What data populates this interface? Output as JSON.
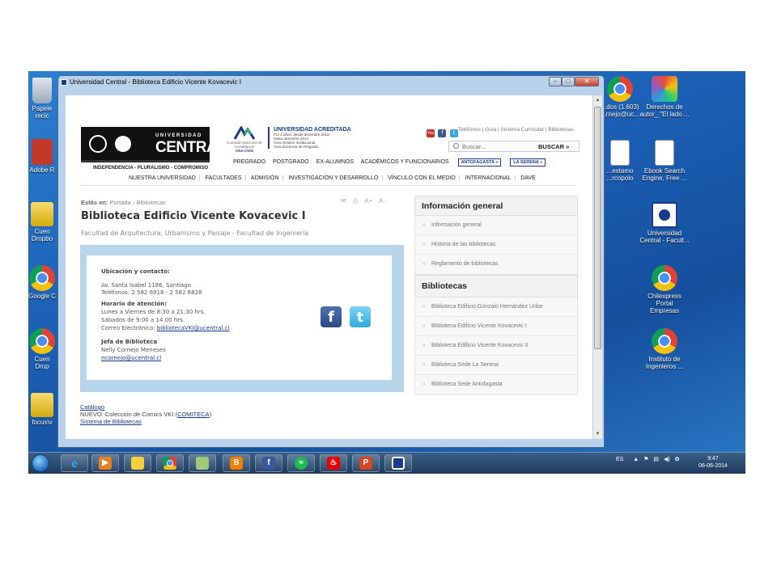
{
  "desktop": {
    "icons_left": [
      {
        "label": "Papelera de\nreciclaje",
        "visible": "Papele\nrecic",
        "icon": "recycle-bin-icon"
      },
      {
        "label": "Adobe Reader",
        "visible": "Adobe R",
        "icon": "pdf-icon"
      },
      {
        "label": "Cuenta Dropbox",
        "visible": "Cuen\nDropbo",
        "icon": "folder-icon"
      },
      {
        "label": "Google Chrome",
        "visible": "Google C",
        "icon": "chrome-icon"
      },
      {
        "label": "Cuenta Dropbox",
        "visible": "Cuen\nDrop",
        "icon": "chrome-icon"
      },
      {
        "label": "focus",
        "visible": "focus\\v",
        "icon": "folder-icon"
      }
    ],
    "icons_right": [
      {
        "label": "...dos (1.603)\n...rnejo@uc...",
        "icon": "chrome-icon"
      },
      {
        "label": "Derechos de\nautor_ \"El lado ...",
        "icon": "color-wheel-icon"
      },
      {
        "label": "...estamo\n...rcopolo",
        "icon": "document-icon"
      },
      {
        "label": "Ebook Search\nEngine, Free ...",
        "icon": "document-icon"
      },
      {
        "label": "Universidad\nCentral - Facult...",
        "icon": "uc-shortcut-icon"
      },
      {
        "label": "Chilexpress Portal\nEmpresas",
        "icon": "chrome-icon"
      },
      {
        "label": "Instituto de\nIngenieros ...",
        "icon": "chrome-icon"
      }
    ]
  },
  "window": {
    "title": "Universidad Central - Biblioteca Edificio Vicente Kovacevic I",
    "min": "–",
    "max": "□",
    "close": "✕"
  },
  "site": {
    "logo_univ": "UNIVERSIDAD",
    "logo_central": "CENTRAL",
    "motto": "INDEPENDENCIA - PLURALISMO - COMPROMISO",
    "cna_name": "Comisión Nacional de Acreditación",
    "cna_short": "CNA-Chile",
    "acred_title": "UNIVERSIDAD ACREDITADA",
    "acred_details": "Por 2 años, desde diciembre 2012,\nhasta diciembre 2014\nÁrea Gestión Institucional\nÁrea Docencia de Pregrado",
    "youtube": "You",
    "top_links": "Teléfonos  |  Guía  |  Sistema Curricular  |  Bibliotecas",
    "search_placeholder": "Buscar...",
    "search_button": "BUSCAR »",
    "main_nav": [
      "PREGRADO",
      "POSTGRADO",
      "EX-ALUMNOS",
      "ACADÉMICOS Y FUNCIONARIOS"
    ],
    "campus_buttons": [
      "ANTOFAGASTA »",
      "LA SERENA »"
    ],
    "secondary_nav": [
      "NUESTRA UNIVERSIDAD",
      "FACULTADES",
      "ADMISIÓN",
      "INVESTIGACIÓN Y DESARROLLO",
      "VÍNCULO CON EL MEDIO",
      "INTERNACIONAL",
      "DAVE"
    ]
  },
  "content": {
    "breadcrumb_label": "Estás en:",
    "breadcrumb_path": "Portada › Bibliotecas",
    "tools": [
      "✉",
      "⎙",
      "A+",
      "A-"
    ],
    "title": "Biblioteca Edificio Vicente Kovacevic I",
    "subtitle": "Facultad de Arquitectura, Urbanismo y Paisaje - Facultad de Ingeniería",
    "contact": {
      "heading": "Ubicación y contacto:",
      "address": "Av. Santa Isabel 1186, Santiago",
      "phones": "Teléfonos: 2 582 6918 - 2 582 6828",
      "hours_heading": "Horario de atención:",
      "hours_weekdays": "Lunes a Viernes de 8:30 a 21:30 hrs.",
      "hours_saturday": "Sábados de 9:00 a 14.00 hrs.",
      "email_label": "Correo Electrónico:",
      "email": "bibliotecaVKI@ucentral.cl",
      "head_heading": "Jefa de Biblioteca",
      "head_name": "Nelly Cornejo Meneses",
      "head_email": "ncornejo@ucentral.cl"
    },
    "footer": {
      "catalog": "Catálogo",
      "new_prefix": "NUEVO: Colección de Comics VKI (",
      "comiteca": "COMITECA",
      "new_suffix": ")",
      "system": "Sistema de Bibliotecas"
    }
  },
  "sidebar": {
    "info_heading": "Información general",
    "info_items": [
      "Información general",
      "Historia de las bibliotecas",
      "Reglamento de bibliotecas"
    ],
    "lib_heading": "Bibliotecas",
    "lib_items": [
      "Biblioteca Edificio Gonzalo Hernández Uribe",
      "Biblioteca Edificio Vicente Kovacevic I",
      "Biblioteca Edificio Vicente Kovacevic II",
      "Biblioteca Sede La Serena",
      "Biblioteca Sede Antofagasta"
    ]
  },
  "taskbar": {
    "apps": [
      "ie-icon",
      "media-player-icon",
      "explorer-icon",
      "chrome-icon",
      "paint-icon",
      "blogger-icon",
      "facebook-icon",
      "spotify-icon",
      "santander-icon",
      "powerpoint-icon",
      "uc-icon"
    ],
    "lang": "ES",
    "time": "9:47",
    "date": "06-06-2014"
  },
  "colors": {
    "brand_navy": "#1a3a8a",
    "contact_frame": "#b7d6ec",
    "taskbar": "#1e3a5c"
  }
}
